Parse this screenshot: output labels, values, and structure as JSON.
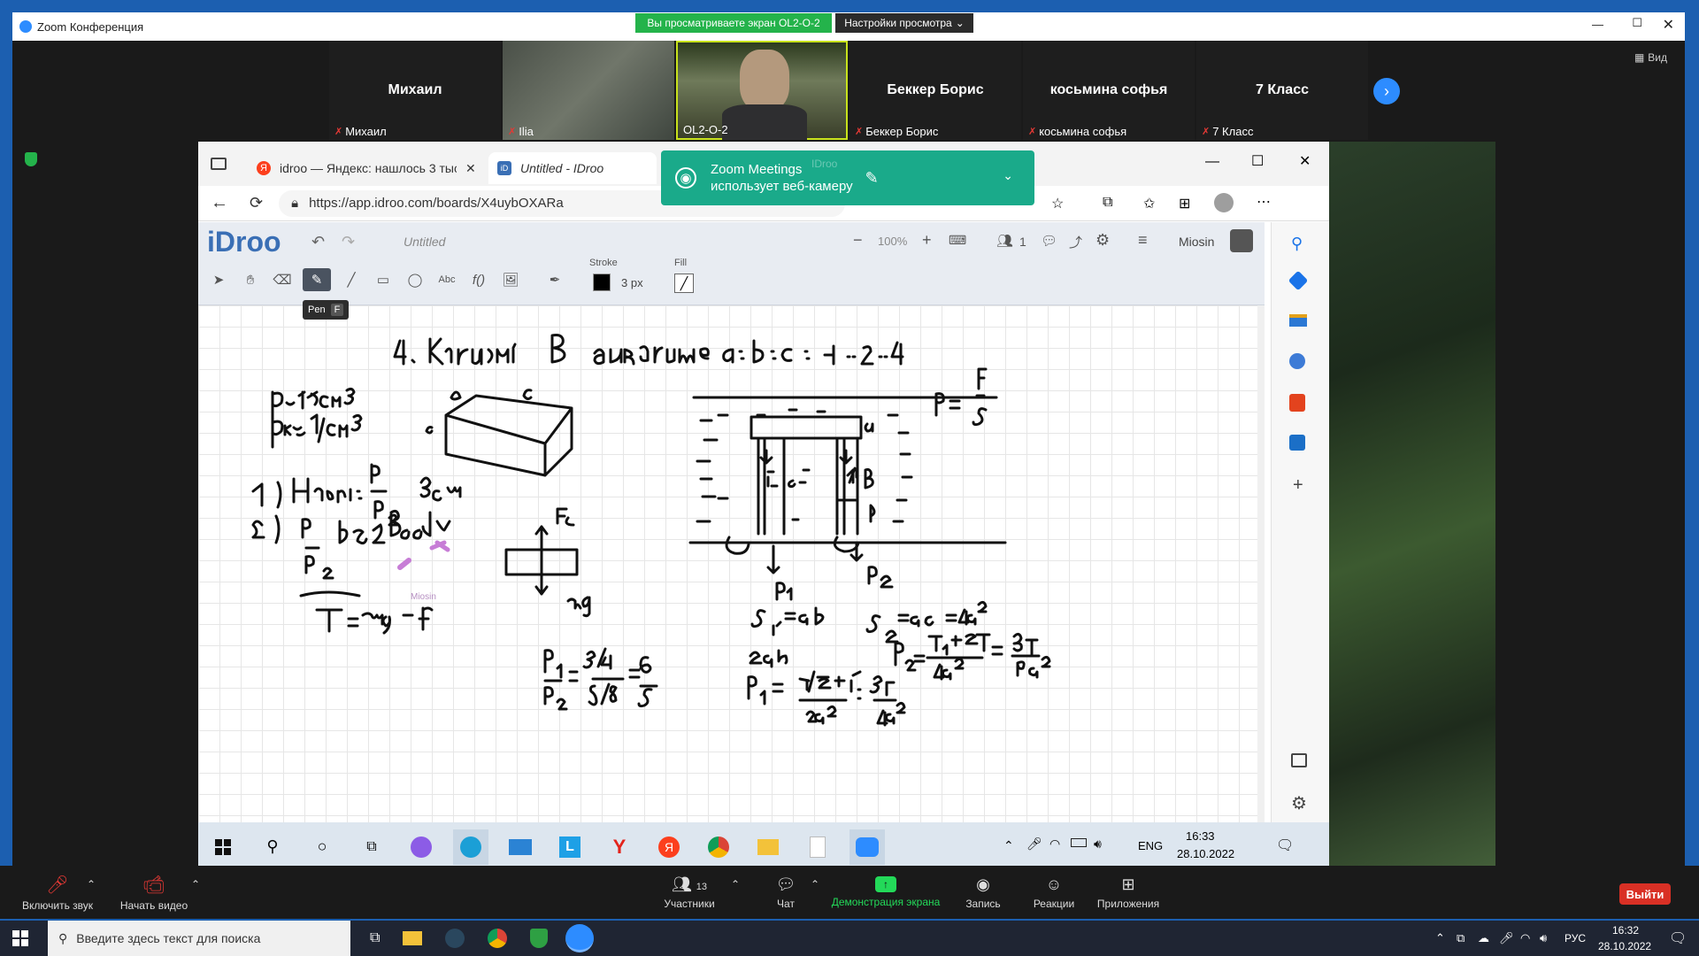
{
  "zoom": {
    "window_title": "Zoom Конференция",
    "share_banner": "Вы просматриваете экран OL2-O-2",
    "view_options": "Настройки просмотра",
    "view_button": "Вид",
    "participants": [
      {
        "name": "Михаил",
        "label": "Михаил",
        "type": "name"
      },
      {
        "name": "",
        "label": "Ilia",
        "type": "video-blur"
      },
      {
        "name": "",
        "label": "OL2-O-2",
        "type": "video-person"
      },
      {
        "name": "Беккер Борис",
        "label": "Беккер Борис",
        "type": "name"
      },
      {
        "name": "косьмина софья",
        "label": "косьмина софья",
        "type": "name"
      },
      {
        "name": "7 Класс",
        "label": "7 Класс",
        "type": "name"
      }
    ],
    "controls": {
      "unmute": "Включить звук",
      "start_video": "Начать видео",
      "participants": "Участники",
      "participants_count": "13",
      "chat": "Чат",
      "share": "Демонстрация экрана",
      "record": "Запись",
      "reactions": "Реакции",
      "apps": "Приложения",
      "leave": "Выйти"
    }
  },
  "browser": {
    "tabs": [
      {
        "title": "idroo — Яндекс: нашлось 3 тыс"
      },
      {
        "title": "Untitled - IDroo"
      }
    ],
    "url": "https://app.idroo.com/boards/X4uybOXARa",
    "toast_title": "Zoom Meetings",
    "toast_sub": "использует веб-камеру",
    "toast_bg_tab": "IDroo"
  },
  "idroo": {
    "logo": "iDroo",
    "board_title": "Untitled",
    "zoom_level": "100%",
    "users_count": "1",
    "username": "Miosin",
    "stroke_label": "Stroke",
    "fill_label": "Fill",
    "stroke_width": "3 px",
    "tooltip": "Pen",
    "tooltip_key": "F",
    "cursor_user": "Miosin"
  },
  "taskbar_inner": {
    "lang": "ENG",
    "time": "16:33",
    "date": "28.10.2022"
  },
  "windows": {
    "search_placeholder": "Введите здесь текст для поиска",
    "lang": "РУС",
    "time": "16:32",
    "date": "28.10.2022"
  },
  "colors": {
    "zoom_green": "#24b34b",
    "toast": "#1aaa8a",
    "leave_red": "#d93025",
    "share_green": "#23d959"
  }
}
